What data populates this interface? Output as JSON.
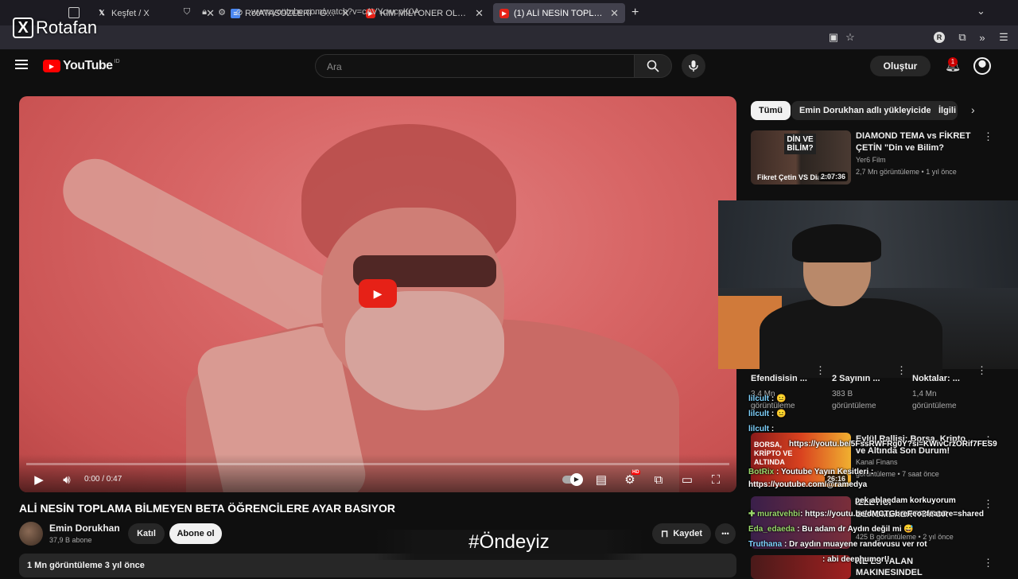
{
  "browser": {
    "tabs": [
      {
        "title": "Keşfet / X",
        "favicon": "x-logo"
      },
      {
        "title": "RotATASÖZLERİ - Google Dokümanlar",
        "favicon": "docs"
      },
      {
        "title": "KİM MİLYONER OLMAK İSTERE",
        "favicon": "youtube"
      },
      {
        "title": "(1) ALİ NESİN TOPLAMA BİLMEYEN",
        "favicon": "youtube",
        "active": true
      }
    ],
    "url": "www.youtube.com/watch?v=cAVYcwcpK0A",
    "profile_initial": "R"
  },
  "watermark": {
    "text": "Rotafan"
  },
  "header": {
    "logo_text": "YouTube",
    "logo_sup": "ID",
    "search_placeholder": "Ara",
    "create_label": "Oluştur",
    "notification_count": "1"
  },
  "player": {
    "time": "0:00 / 0:47",
    "progress": 0.0,
    "hd_badge": "HD"
  },
  "video": {
    "title": "ALİ NESİN TOPLAMA BİLMEYEN BETA ÖĞRENCİLERE AYAR BASIYOR",
    "channel": "Emin Dorukhan",
    "subscribers": "37,9 B abone",
    "join_label": "Katıl",
    "subscribe_label": "Abone ol",
    "save_label": "Kaydet",
    "more_label": "•••",
    "description_meta": "1 Mn görüntüleme  3 yıl önce",
    "overlay_caption": "#Öndeyiz"
  },
  "sidebar": {
    "chips": [
      "Tümü",
      "Emin Dorukhan adlı yükleyiciden",
      "İlgili"
    ],
    "recs": [
      {
        "title": "DIAMOND TEMA vs FİKRET ÇETİN \"Din ve Bilim?",
        "channel": "Yer6 Film",
        "meta": "2,7 Mn görüntüleme • 1 yıl önce",
        "duration": "2:07:36",
        "thumb_text_top": "DİN VE BİLİM?",
        "thumb_text_bottom": "Fikret Çetin VS Diamo"
      },
      {
        "title": "Eylül Rallisi: Borsa, Kripto ve Altında Son Durum!",
        "channel": "Kanal Finans",
        "meta": "görüntüleme • 7 saat önce",
        "duration": "26:16",
        "thumb_text": "BORSA, KRİPTO VE ALTINDA"
      }
    ],
    "shorts": [
      {
        "title": "Efendisisin ...",
        "views": "3,4 Mn",
        "views_label": "görüntüleme"
      },
      {
        "title": "2 Sayının ...",
        "views": "383 B",
        "views_label": "görüntüleme"
      },
      {
        "title": "Noktalar: ...",
        "views": "1,4 Mn",
        "views_label": "görüntüleme"
      }
    ],
    "partial": {
      "title_a": "İZLETICI BEROMEKERTRATOR",
      "meta_a": "425 B görüntüleme • 2 yıl önce",
      "title_b": "NE LS YALAN",
      "title_c": "MAKINESINDEL"
    }
  },
  "chat": [
    {
      "user": "lilcult",
      "text": ": 😐"
    },
    {
      "user": "lilcult",
      "text": ": 😐"
    },
    {
      "user": "lilcult",
      "text": ":"
    },
    {
      "user": "",
      "text": "https://youtu.be/5FssRWFRg0Y?si=KWivCrzORif7FES9"
    },
    {
      "user": "BotRix",
      "text": ": Youtube Yayın Kesitleri :"
    },
    {
      "user": "",
      "text": "https://youtube.com/@ramedya"
    },
    {
      "user": "",
      "text": "pek ablaedam korkuyorum"
    },
    {
      "user": "muratvehbi",
      "text": ": https://youtu.be/dMCTGbreFeo?feature=shared"
    },
    {
      "user": "Eda_edaeda",
      "text": ": Bu adam dr Aydın değil mi 😅"
    },
    {
      "user": "Truthana",
      "text": ": Dr aydın muayene randevusu ver rot"
    },
    {
      "user": "",
      "text": ": abi deephumor!!"
    }
  ]
}
